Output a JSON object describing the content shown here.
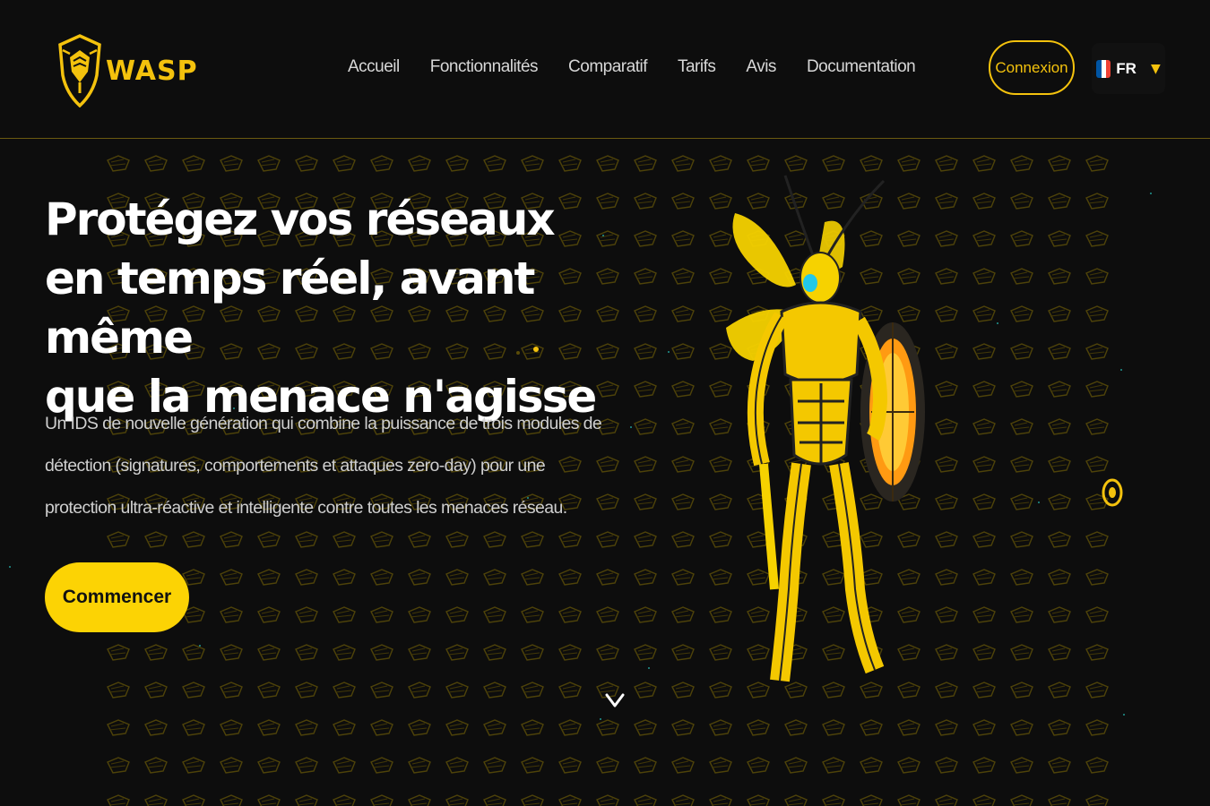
{
  "brand": {
    "name": "WASP"
  },
  "nav": {
    "items": [
      {
        "label": "Accueil"
      },
      {
        "label": "Fonctionnalités"
      },
      {
        "label": "Comparatif"
      },
      {
        "label": "Tarifs"
      },
      {
        "label": "Avis"
      },
      {
        "label": "Documentation"
      }
    ]
  },
  "header": {
    "login_label": "Connexion",
    "language": {
      "code": "FR",
      "flag": "france-flag-icon"
    }
  },
  "hero": {
    "title_lines": [
      "Protégez vos réseaux",
      "en temps réel, avant même",
      "que la menace n'agisse"
    ],
    "description": "Un IDS de nouvelle génération qui combine la puissance de trois modules de détection (signatures, comportements et attaques zero-day) pour une protection ultra-réactive et intelligente contre toutes les menaces réseau.",
    "cta_label": "Commencer",
    "illustration": "armored-wasp-with-shield-illustration"
  },
  "icons": {
    "logo": "wasp-shield-logo-icon",
    "caret": "chevron-down-icon",
    "scroll": "chevron-down-icon",
    "target": "target-icon"
  },
  "colors": {
    "accent": "#fcd304",
    "accent_border": "#f4c20d",
    "background": "#0d0d0d",
    "text": "#ffffff",
    "muted_text": "#cfcfcf",
    "particles": "#2bd4cc"
  }
}
